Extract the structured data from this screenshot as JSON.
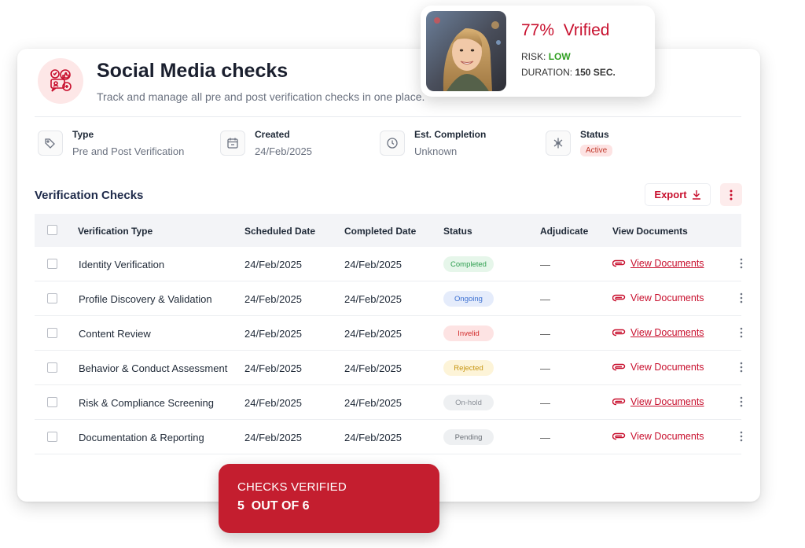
{
  "header": {
    "title": "Social Media checks",
    "subtitle": "Track and manage all pre and post verification checks in one place.",
    "icon": "social-media-icon"
  },
  "meta": {
    "type": {
      "label": "Type",
      "value": "Pre and Post Verification",
      "icon": "tag-icon"
    },
    "created": {
      "label": "Created",
      "value": "24/Feb/2025",
      "icon": "calendar-icon"
    },
    "completion": {
      "label": "Est. Completion",
      "value": "Unknown",
      "icon": "clock-icon"
    },
    "status": {
      "label": "Status",
      "value": "Active",
      "icon": "status-icon"
    }
  },
  "section": {
    "title": "Verification Checks",
    "export_label": "Export"
  },
  "table": {
    "columns": [
      "Verification Type",
      "Scheduled Date",
      "Completed Date",
      "Status",
      "Adjudicate",
      "View Documents"
    ],
    "rows": [
      {
        "type": "Identity Verification",
        "scheduled": "24/Feb/2025",
        "completed": "24/Feb/2025",
        "status": "Completed",
        "adjudicate": "—",
        "docs": "View Documents"
      },
      {
        "type": "Profile Discovery & Validation",
        "scheduled": "24/Feb/2025",
        "completed": "24/Feb/2025",
        "status": "Ongoing",
        "adjudicate": "—",
        "docs": "View Documents"
      },
      {
        "type": "Content Review",
        "scheduled": "24/Feb/2025",
        "completed": "24/Feb/2025",
        "status": "Invelid",
        "adjudicate": "—",
        "docs": "View Documents"
      },
      {
        "type": "Behavior & Conduct Assessment",
        "scheduled": "24/Feb/2025",
        "completed": "24/Feb/2025",
        "status": "Rejected",
        "adjudicate": "—",
        "docs": "View Documents"
      },
      {
        "type": "Risk & Compliance Screening",
        "scheduled": "24/Feb/2025",
        "completed": "24/Feb/2025",
        "status": "On-hold",
        "adjudicate": "—",
        "docs": "View Documents"
      },
      {
        "type": "Documentation & Reporting",
        "scheduled": "24/Feb/2025",
        "completed": "24/Feb/2025",
        "status": "Pending",
        "adjudicate": "—",
        "docs": "View Documents"
      }
    ]
  },
  "profile": {
    "percent": "77%",
    "verified_label": "Vrified",
    "risk_label": "RISK:",
    "risk_value": "LOW",
    "duration_label": "DURATION:",
    "duration_value": "150 SEC."
  },
  "summary": {
    "line1": "CHECKS VERIFIED",
    "line2": "5  OUT OF 6"
  },
  "colors": {
    "accent": "#c8102e",
    "risk_low": "#2e9e1f",
    "status_completed": "#2e9e4f",
    "status_ongoing": "#3b6fd1",
    "status_invalid": "#d12a2a",
    "status_rejected": "#c79612"
  }
}
